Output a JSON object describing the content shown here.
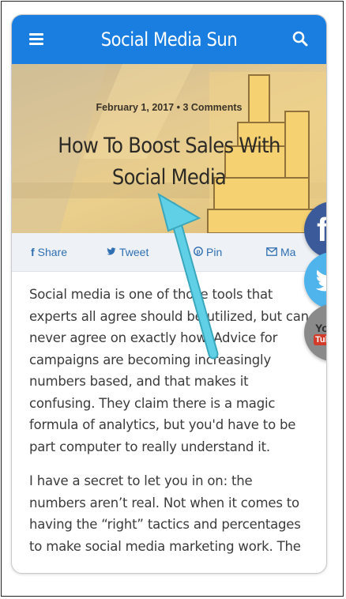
{
  "header": {
    "site_title": "Social Media Sun",
    "menu_icon": "hamburger-icon",
    "search_icon": "search-icon",
    "brand_color": "#1a7de0"
  },
  "article": {
    "date": "February 1, 2017",
    "comments": "3 Comments",
    "title": "How To Boost Sales With Social Media"
  },
  "share_bar": {
    "items": [
      {
        "icon": "facebook-icon",
        "glyph": "f",
        "label": "Share"
      },
      {
        "icon": "twitter-icon",
        "glyph": "🐦",
        "label": "Tweet"
      },
      {
        "icon": "pinterest-icon",
        "glyph": "℗",
        "label": "Pin"
      },
      {
        "icon": "mail-icon",
        "glyph": "✉",
        "label": "Ma"
      }
    ]
  },
  "floating_social": {
    "facebook": {
      "letter": "f",
      "color": "#3b5a9a"
    },
    "twitter": {
      "color": "#4fb3ec"
    },
    "youtube": {
      "top": "You",
      "bottom": "Tube",
      "color": "#8a8a8a"
    }
  },
  "body_text": {
    "paragraph_1": "Social media is one of those tools that experts all agree should be utilized, but can never agree on exactly how. Advice for campaigns are becoming increasingly numbers based, and that makes it confusing. They claim there is a magic formula of analytics, but you'd have to be part computer to really understand it.",
    "paragraph_2": "I have a secret to let you in on: the numbers aren’t real. Not when it comes to having the “right” tactics and percentages to make social media marketing work. The"
  },
  "annotation": {
    "arrow_color": "#5fd0e6"
  }
}
